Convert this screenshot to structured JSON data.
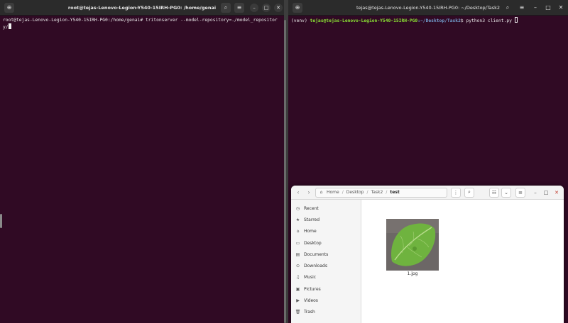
{
  "terminal_left": {
    "title": "root@tejas-Lenovo-Legion-Y540-15IRH-PG0: /home/genai",
    "prompt": "root@tejas-Lenovo-Legion-Y540-15IRH-PG0:/home/genai# ",
    "command": "tritonserver --model-repository=./model_repository/"
  },
  "terminal_right": {
    "title": "tejas@tejas-Lenovo-Legion-Y540-15IRH-PG0: ~/Desktop/Task2",
    "venv": "(venv) ",
    "user_host": "tejas@tejas-Lenovo-Legion-Y540-15IRH-PG0",
    "path": ":~/Desktop/Task2",
    "dollar": "$ ",
    "command": "python3 client.py "
  },
  "files": {
    "breadcrumb": [
      "Home",
      "Desktop",
      "Task2",
      "test"
    ],
    "sidebar": [
      {
        "label": "Recent",
        "icon": "clock-icon"
      },
      {
        "label": "Starred",
        "icon": "star-icon"
      },
      {
        "label": "Home",
        "icon": "home-icon"
      },
      {
        "label": "Desktop",
        "icon": "desktop-icon"
      },
      {
        "label": "Documents",
        "icon": "documents-icon"
      },
      {
        "label": "Downloads",
        "icon": "downloads-icon"
      },
      {
        "label": "Music",
        "icon": "music-icon"
      },
      {
        "label": "Pictures",
        "icon": "pictures-icon"
      },
      {
        "label": "Videos",
        "icon": "videos-icon"
      },
      {
        "label": "Trash",
        "icon": "trash-icon"
      }
    ],
    "file": {
      "name": "1.jpg"
    }
  },
  "colors": {
    "terminal_bg": "#300a24",
    "prompt_user": "#8ae234",
    "prompt_path": "#729fcf"
  }
}
